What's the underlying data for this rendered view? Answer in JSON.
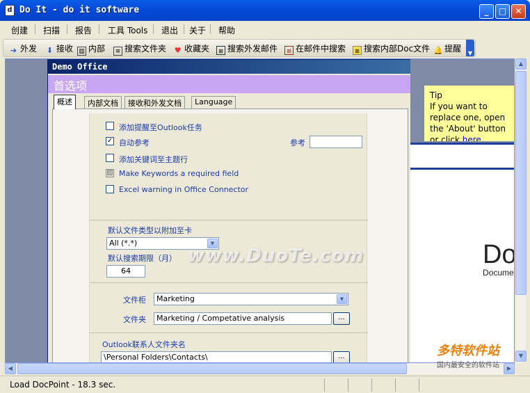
{
  "window": {
    "title": "Do It - do it software",
    "min": "_",
    "max": "□",
    "close": "✕"
  },
  "menu": [
    "创建",
    "扫描",
    "报告",
    "工具 Tools",
    "退出",
    "关于",
    "帮助"
  ],
  "toolbar": [
    {
      "label": "外发",
      "icon": "arrow-up-icon"
    },
    {
      "label": "接收",
      "icon": "arrow-down-icon"
    },
    {
      "label": "内部",
      "icon": "book-icon"
    },
    {
      "label": "搜索文件夹",
      "icon": "search-folder-icon"
    },
    {
      "label": "收藏夹",
      "icon": "heart-icon"
    },
    {
      "label": "搜索外发邮件",
      "icon": "search-outbox-icon"
    },
    {
      "label": "在邮件中搜索",
      "icon": "search-mail-icon"
    },
    {
      "label": "搜索内部Doc文件",
      "icon": "search-doc-icon"
    },
    {
      "label": "提醒",
      "icon": "bell-icon"
    }
  ],
  "dialog": {
    "title": "Demo Office",
    "header": "首选项",
    "tabs": [
      "概述",
      "内部文档",
      "接收和外发文档",
      "Language"
    ],
    "checks": {
      "add_reminder": "添加提醒至Outlook任务",
      "auto_ref": "自动参考",
      "add_keywords": "添加关键词至主题行",
      "keywords_required": "Make Keywords a required field",
      "excel_warning": "Excel warning in Office Connector"
    },
    "ref_label": "参考",
    "ref_value": "",
    "default_file_type_label": "默认文件类型以附加至卡",
    "default_file_type_value": "All (*.*)",
    "search_period_label": "默认搜索期限（月）",
    "search_period_value": "64",
    "cabinet_label": "文件柜",
    "cabinet_value": "Marketing",
    "folder_label": "文件夹",
    "folder_value": "Marketing / Competative analysis",
    "outlook_label": "Outlook联系人文件夹名",
    "outlook_value": "\\Personal Folders\\Contacts\\",
    "browse": "..."
  },
  "tip": {
    "title": "Tip",
    "text": "If you want to replace one, open the 'About' button or click ",
    "link": "here"
  },
  "brand": {
    "big": "Do",
    "small": "Docume"
  },
  "watermark": "www.DuoTe.com",
  "corner_logo": {
    "big": "多特软件站",
    "small": "国内最安全的软件站"
  },
  "status": "Load DocPoint - 18.3 sec."
}
